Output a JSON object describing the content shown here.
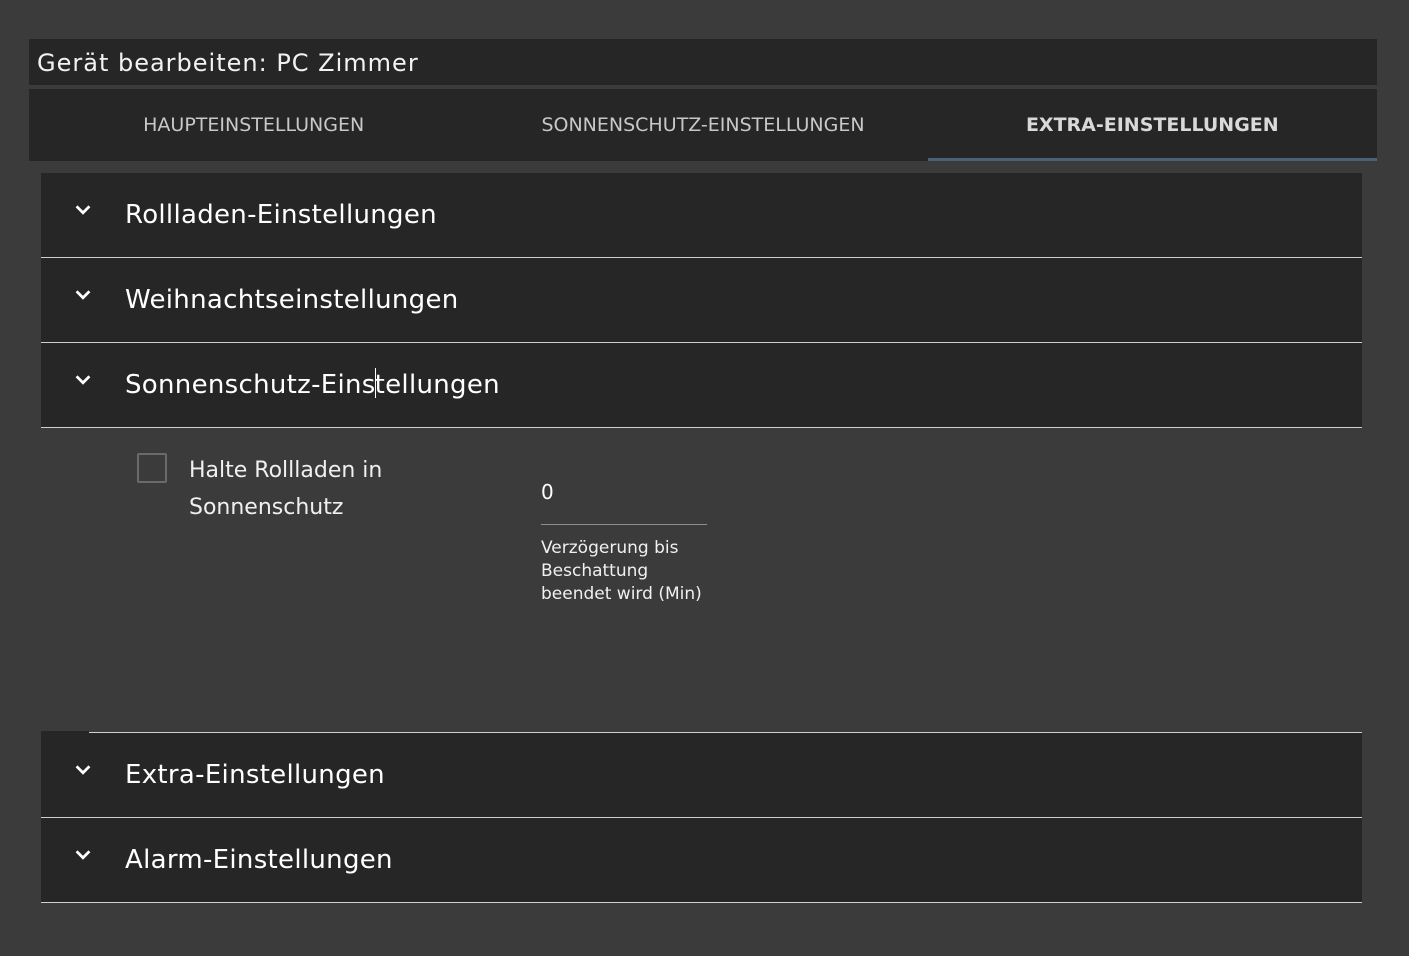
{
  "dialog": {
    "title": "Gerät bearbeiten: PC Zimmer"
  },
  "tabs": [
    {
      "label": "HAUPTEINSTELLUNGEN",
      "active": false
    },
    {
      "label": "SONNENSCHUTZ-EINSTELLUNGEN",
      "active": false
    },
    {
      "label": "EXTRA-EINSTELLUNGEN",
      "active": true
    }
  ],
  "sections": {
    "rollladen": {
      "title": "Rollladen-Einstellungen",
      "icon": "chevron-down-icon"
    },
    "weihnachten": {
      "title": "Weihnachtseinstellungen",
      "icon": "chevron-down-icon"
    },
    "sonnenschutz": {
      "title_part1": "Sonnenschutz-Eins",
      "title_part2": "tellungen",
      "icon": "chevron-down-icon",
      "expanded": true,
      "checkbox_label": "Halte Rollladen in Sonnenschutz",
      "checkbox_checked": false,
      "delay_value": "0",
      "delay_helper": "Verzögerung bis Beschattung beendet wird (Min)"
    },
    "extra": {
      "title": "Extra-Einstellungen",
      "icon": "chevron-down-icon"
    },
    "alarm": {
      "title": "Alarm-Einstellungen",
      "icon": "chevron-down-icon"
    }
  },
  "colors": {
    "background": "#3b3b3b",
    "surface": "#262626",
    "tab_indicator": "#4a6178"
  }
}
